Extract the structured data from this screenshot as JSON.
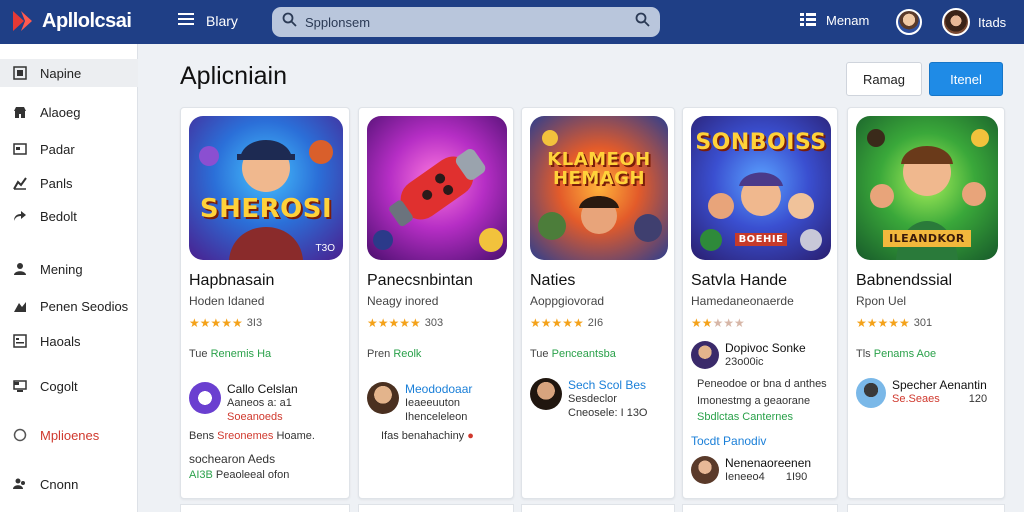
{
  "app": {
    "name": "Apllolcsai"
  },
  "header": {
    "menu_label": "Blary",
    "search_placeholder": "Spplonsem",
    "members_label": "Menam",
    "user_name": "Itads"
  },
  "sidebar": {
    "items": [
      {
        "label": "Napine",
        "icon": "square-icon"
      },
      {
        "label": "Alaoeg",
        "icon": "store-icon"
      },
      {
        "label": "Padar",
        "icon": "window-icon"
      },
      {
        "label": "Panls",
        "icon": "chart-icon"
      },
      {
        "label": "Bedolt",
        "icon": "share-icon"
      },
      {
        "label": "Mening",
        "icon": "person-icon"
      },
      {
        "label": "Penen Seodios",
        "icon": "chart-icon"
      },
      {
        "label": "Haoals",
        "icon": "document-icon"
      },
      {
        "label": "Cogolt",
        "icon": "monitor-icon"
      },
      {
        "label": "Mplioenes",
        "icon": "circle-icon"
      },
      {
        "label": "Cnonn",
        "icon": "people-icon"
      }
    ]
  },
  "main": {
    "title": "Aplicniain",
    "secondary_button": "Ramag",
    "primary_button": "Itenel"
  },
  "cards": [
    {
      "thumb_text": "SHEROSI",
      "thumb_sub": "T3O",
      "title": "Hapbnasain",
      "developer": "Hoden Idaned",
      "stars": 5,
      "rating": "3I3",
      "tag_prefix": "Tue",
      "tag_link": "Renemis Ha",
      "review1_name": "Callo Celslan",
      "review1_line2": "Aaneos a: a1",
      "review1_line3": "Soeanoeds",
      "line_a_prefix": "Bens",
      "line_a_red": "Sreonemes",
      "line_a_suffix": "Hoame.",
      "line_b": "sochearon Aeds",
      "line_c_green": "AI3B",
      "line_c": "Peaoleeal ofon"
    },
    {
      "thumb_text": "",
      "thumb_sub": "",
      "title": "Panecsnbintan",
      "developer": "Neagy inored",
      "stars": 5,
      "rating": "303",
      "tag_prefix": "Pren",
      "tag_link": "Reolk",
      "review1_name": "Meododoaar",
      "review1_line2": "Ieaeeuuton",
      "review1_line3": "Ihenceleleon",
      "line_a_prefix": "Ifas",
      "line_a_red": "",
      "line_a_suffix": "benahachiny",
      "line_b": "",
      "line_c_green": "",
      "line_c": ""
    },
    {
      "thumb_text": "KLAMEOH HEMAGH",
      "thumb_sub": "",
      "title": "Naties",
      "developer": "Aoppgiovorad",
      "stars": 5,
      "rating": "2I6",
      "tag_prefix": "Tue",
      "tag_link": "Penceantsba",
      "review1_name": "Sech Scol Bes",
      "review1_line2": "Sesdeclor",
      "review1_line3": "Cneosele: I 13O",
      "line_a_prefix": "",
      "line_a_red": "",
      "line_a_suffix": "",
      "line_b": "",
      "line_c_green": "",
      "line_c": ""
    },
    {
      "thumb_text": "SONBOISS",
      "thumb_sub": "BOEHIE",
      "title": "Satvla Hande",
      "developer": "Hamedaneonaerde",
      "stars": 2,
      "rating": "",
      "tag_prefix": "",
      "tag_link": "",
      "review1_name": "Dopivoc Sonke",
      "review1_line2": "23o00ic",
      "review1_line3": "",
      "line_a_prefix": "Peneodoe or bna",
      "line_a_red": "",
      "line_a_suffix": "d anthes",
      "line_b": "Imonestmg a geaorane",
      "line_c_green": "Sbdlctas Canternes",
      "line_c": "",
      "blue_link": "Tocdt Panodiv",
      "review2_name": "Nenenaoreenen",
      "review2_line2": "Ieneeo4",
      "review2_rating": "1I90"
    },
    {
      "thumb_text": "ILEANDKOR",
      "thumb_sub": "",
      "title": "Babnendssial",
      "developer": "Rpon Uel",
      "stars": 5,
      "rating": "301",
      "tag_prefix": "Tls",
      "tag_link": "Penams Aoe",
      "review1_name": "Specher Aenantin",
      "review1_line2": "Se.Seaes",
      "review1_line3": "",
      "review1_rating": "120",
      "line_a_prefix": "",
      "line_a_red": "",
      "line_a_suffix": "",
      "line_b": "",
      "line_c_green": "",
      "line_c": ""
    }
  ],
  "colors": {
    "header": "#1f3f86",
    "primary": "#1f8be6",
    "star": "#f4a21a",
    "link_green": "#2aa14a",
    "accent_red": "#d0392e"
  }
}
